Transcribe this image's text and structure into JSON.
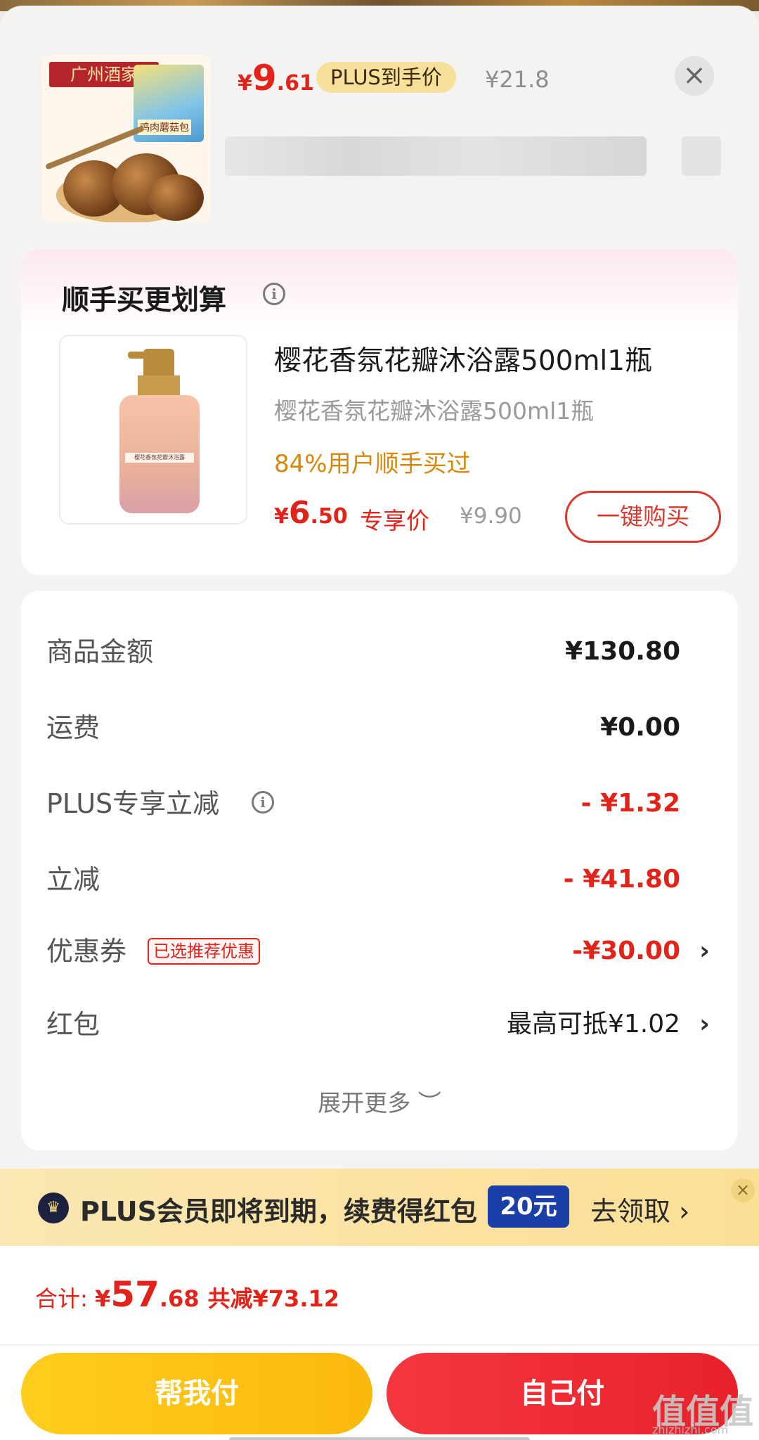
{
  "header": {
    "thumb_logo": "广州酒家",
    "thumb_pack": "鸡肉蘑菇包",
    "price_symbol": "¥",
    "price_int": "9",
    "price_dec": ".61",
    "plus_tag": "PLUS到手价",
    "original_price": "¥21.8",
    "close_glyph": "×"
  },
  "upsell": {
    "title": "顺手买更划算",
    "info_glyph": "i",
    "product_name": "樱花香氛花瓣沐浴露500ml1瓶",
    "product_sub": "樱花香氛花瓣沐浴露500ml1瓶",
    "stat": "84%用户顺手买过",
    "price_symbol": "¥",
    "price_int": "6",
    "price_dec": ".50",
    "exclusive_label": "专享价",
    "original_price": "¥9.90",
    "buy_button": "一键购买",
    "bottle_label": "樱花香氛花瓣沐浴露"
  },
  "summary": {
    "rows": [
      {
        "label": "商品金额",
        "value": "¥130.80"
      },
      {
        "label": "运费",
        "value": "¥0.00"
      },
      {
        "label": "PLUS专享立减",
        "value": "- ¥1.32"
      },
      {
        "label": "立减",
        "value": "- ¥41.80"
      },
      {
        "label": "优惠券",
        "badge": "已选推荐优惠",
        "value": "-¥30.00"
      },
      {
        "label": "红包",
        "value": "最高可抵¥1.02"
      }
    ],
    "chevron": "›",
    "expand_label": "展开更多 ︶"
  },
  "plus_banner": {
    "crown_glyph": "♛",
    "text": "PLUS会员即将到期，续费得红包",
    "chip": "20元",
    "go": "去领取 ›",
    "close_glyph": "×"
  },
  "bottom": {
    "total_label": "合计: ",
    "total_symbol": "¥",
    "total_int": "57",
    "total_dec": ".68",
    "saved": "共减¥73.12",
    "help_pay": "帮我付",
    "self_pay": "自己付",
    "watermark": "值值值",
    "watermark_sub": "zhizhizhi.com"
  },
  "colors": {
    "accent_red": "#e2231a",
    "gold": "#f7e09a",
    "orange_stat": "#d9870b",
    "plus_blue": "#1b3fa8"
  }
}
